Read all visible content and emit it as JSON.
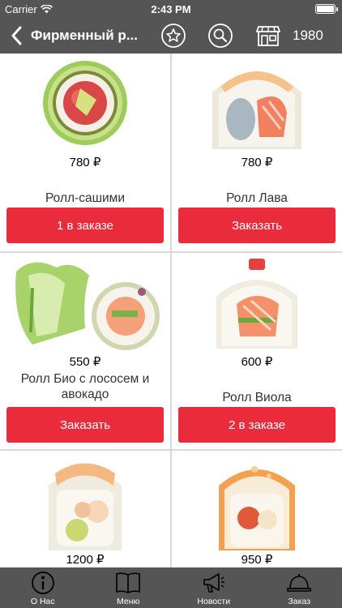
{
  "status_bar": {
    "carrier": "Carrier",
    "time": "2:43 PM",
    "battery_level": 1.0
  },
  "nav": {
    "title": "Фирменный р...",
    "bonus": "1980"
  },
  "products": [
    {
      "price": "780 ₽",
      "name": "Ролл-сашими",
      "button": "1 в заказе",
      "image_icon": "roll-sashimi-image"
    },
    {
      "price": "780 ₽",
      "name": "Ролл  Лава",
      "button": "Заказать",
      "image_icon": "roll-lava-image"
    },
    {
      "price": "550 ₽",
      "name": "Ролл Био с лососем и авокадо",
      "button": "Заказать",
      "image_icon": "roll-bio-image"
    },
    {
      "price": "600 ₽",
      "name": "Ролл Виола",
      "button": "2 в заказе",
      "image_icon": "roll-viola-image"
    },
    {
      "price": "1200 ₽",
      "name": "",
      "button": "",
      "image_icon": "roll-image"
    },
    {
      "price": "950 ₽",
      "name": "",
      "button": "",
      "image_icon": "roll-image"
    }
  ],
  "tabs": [
    {
      "label": "О Нас",
      "icon": "info-icon"
    },
    {
      "label": "Меню",
      "icon": "book-icon"
    },
    {
      "label": "Новости",
      "icon": "megaphone-icon"
    },
    {
      "label": "Заказ",
      "icon": "bell-icon"
    }
  ],
  "colors": {
    "bar": "#555555",
    "accent": "#ea2b3c",
    "divider": "#d8d8d8"
  }
}
